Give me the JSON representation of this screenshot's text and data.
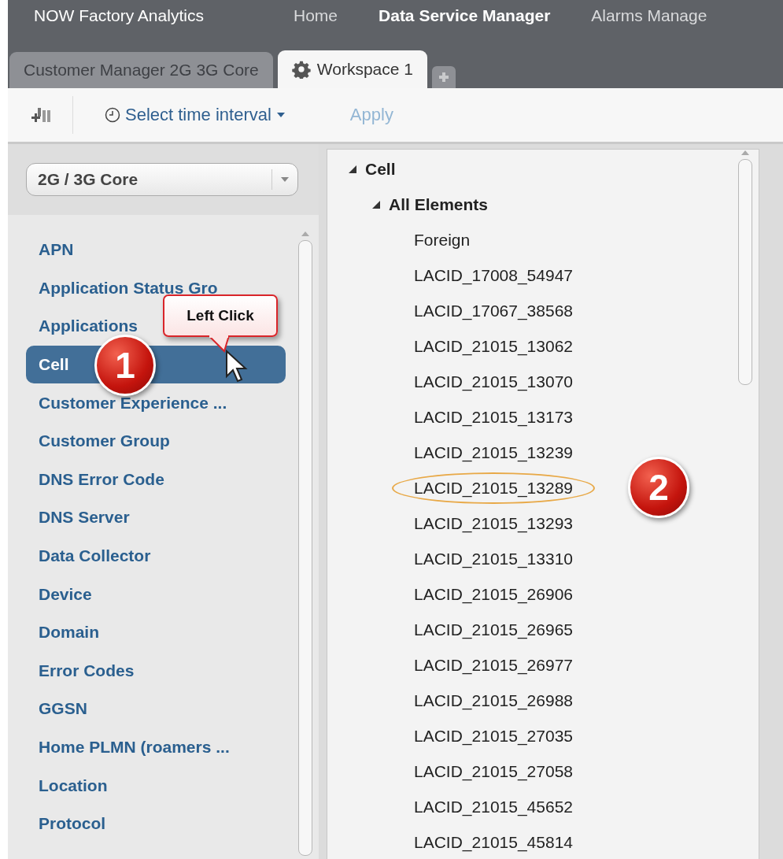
{
  "app_title": "NOW Factory Analytics",
  "nav": [
    {
      "label": "Home",
      "selected": false
    },
    {
      "label": "Data Service Manager",
      "selected": true
    },
    {
      "label": "Alarms Manage",
      "selected": false
    }
  ],
  "tabs": [
    {
      "label": "Customer Manager 2G 3G Core",
      "selected": false
    },
    {
      "label": "Workspace 1",
      "selected": true
    }
  ],
  "toolbar": {
    "time_interval": "Select time interval",
    "apply": {
      "label": "Apply",
      "disabled": true
    }
  },
  "dropdown": {
    "value": "2G / 3G Core"
  },
  "sidebar": {
    "items": [
      {
        "label": "APN",
        "selected": false
      },
      {
        "label": "Application Status Gro",
        "selected": false
      },
      {
        "label": "Applications",
        "selected": false
      },
      {
        "label": "Cell",
        "selected": true
      },
      {
        "label": "Customer Experience ...",
        "selected": false
      },
      {
        "label": "Customer Group",
        "selected": false
      },
      {
        "label": "DNS Error Code",
        "selected": false
      },
      {
        "label": "DNS Server",
        "selected": false
      },
      {
        "label": "Data Collector",
        "selected": false
      },
      {
        "label": "Device",
        "selected": false
      },
      {
        "label": "Domain",
        "selected": false
      },
      {
        "label": "Error Codes",
        "selected": false
      },
      {
        "label": "GGSN",
        "selected": false
      },
      {
        "label": "Home PLMN (roamers ...",
        "selected": false
      },
      {
        "label": "Location",
        "selected": false
      },
      {
        "label": "Protocol",
        "selected": false
      }
    ]
  },
  "tree": [
    {
      "label": "Cell",
      "expanded": true,
      "children": [
        {
          "label": "All Elements",
          "expanded": true,
          "children": [
            {
              "label": "Foreign",
              "circled": false
            },
            {
              "label": "LACID_17008_54947",
              "circled": false
            },
            {
              "label": "LACID_17067_38568",
              "circled": false
            },
            {
              "label": "LACID_21015_13062",
              "circled": false
            },
            {
              "label": "LACID_21015_13070",
              "circled": false
            },
            {
              "label": "LACID_21015_13173",
              "circled": false
            },
            {
              "label": "LACID_21015_13239",
              "circled": false
            },
            {
              "label": "LACID_21015_13289",
              "circled": true
            },
            {
              "label": "LACID_21015_13293",
              "circled": false
            },
            {
              "label": "LACID_21015_13310",
              "circled": false
            },
            {
              "label": "LACID_21015_26906",
              "circled": false
            },
            {
              "label": "LACID_21015_26965",
              "circled": false
            },
            {
              "label": "LACID_21015_26977",
              "circled": false
            },
            {
              "label": "LACID_21015_26988",
              "circled": false
            },
            {
              "label": "LACID_21015_27035",
              "circled": false
            },
            {
              "label": "LACID_21015_27058",
              "circled": false
            },
            {
              "label": "LACID_21015_45652",
              "circled": false
            },
            {
              "label": "LACID_21015_45814",
              "circled": false
            }
          ]
        }
      ]
    }
  ],
  "callout": {
    "text": "Left Click"
  },
  "markers": [
    {
      "label": "1"
    },
    {
      "label": "2"
    }
  ]
}
